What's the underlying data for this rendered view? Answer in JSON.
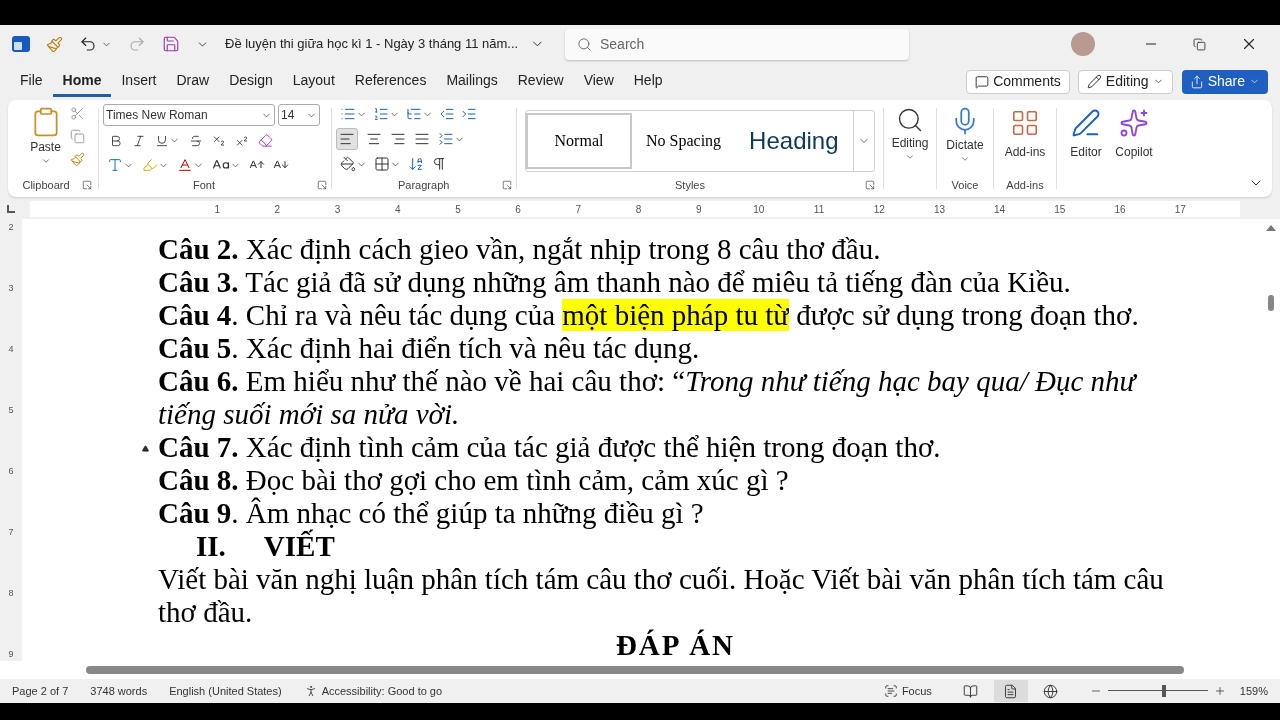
{
  "window": {
    "title": "Đề luyện thi giữa học kì 1 - Ngày 3 tháng 11  năm...",
    "search_placeholder": "Search"
  },
  "tabs": [
    {
      "label": "File",
      "selected": false
    },
    {
      "label": "Home",
      "selected": true
    },
    {
      "label": "Insert",
      "selected": false
    },
    {
      "label": "Draw",
      "selected": false
    },
    {
      "label": "Design",
      "selected": false
    },
    {
      "label": "Layout",
      "selected": false
    },
    {
      "label": "References",
      "selected": false
    },
    {
      "label": "Mailings",
      "selected": false
    },
    {
      "label": "Review",
      "selected": false
    },
    {
      "label": "View",
      "selected": false
    },
    {
      "label": "Help",
      "selected": false
    }
  ],
  "actions": {
    "comments": "Comments",
    "editing": "Editing",
    "share": "Share"
  },
  "ribbon": {
    "paste": "Paste",
    "font_name": "Times New Roman",
    "font_size": "14",
    "groups": [
      "Clipboard",
      "Font",
      "Paragraph",
      "Styles",
      "Voice",
      "Add-ins"
    ],
    "styles": [
      {
        "label": "Normal",
        "kind": "normal",
        "selected": true
      },
      {
        "label": "No Spacing",
        "kind": "nospacing",
        "selected": false
      },
      {
        "label": "Heading",
        "kind": "heading",
        "selected": false
      }
    ],
    "editing": "Editing",
    "dictate": "Dictate",
    "addins": "Add-ins",
    "editor": "Editor",
    "copilot": "Copilot"
  },
  "ruler": [
    "1",
    "2",
    "3",
    "4",
    "5",
    "6",
    "7",
    "8",
    "9",
    "10",
    "11",
    "12",
    "13",
    "14",
    "15",
    "16",
    "17"
  ],
  "vertical_ruler": [
    "2",
    "3",
    "4",
    "5",
    "6",
    "7",
    "8",
    "9"
  ],
  "document": [
    {
      "kind": "question",
      "collapsible": false,
      "segments": [
        {
          "text": "**Câu 2.** Xác định cách gieo vần, ngắt nhịp trong 8 câu thơ đầu.",
          "highlighted": false
        }
      ]
    },
    {
      "kind": "question",
      "collapsible": false,
      "segments": [
        {
          "text": "**Câu 3.** Tác giả đã sử dụng những âm thanh nào để miêu tả tiếng đàn của Kiều.",
          "highlighted": false
        }
      ]
    },
    {
      "kind": "question",
      "collapsible": false,
      "segments": [
        {
          "text": "**Câu 4**. Chỉ ra và nêu tác dụng của ",
          "highlighted": false
        },
        {
          "text": "một biện pháp tu từ",
          "highlighted": true
        },
        {
          "text": " được sử dụng trong đoạn thơ.",
          "highlighted": false
        }
      ]
    },
    {
      "kind": "question",
      "collapsible": false,
      "segments": [
        {
          "text": "**Câu 5**. Xác định hai điển tích và nêu tác dụng.",
          "highlighted": false
        }
      ]
    },
    {
      "kind": "question",
      "collapsible": false,
      "segments": [
        {
          "text": "**Câu 6.** Em hiểu như thế nào về hai câu thơ: “*Trong như tiếng hạc bay qua/ Đục như tiếng suối mới sa nửa vời.*",
          "highlighted": false
        }
      ]
    },
    {
      "kind": "question",
      "collapsible": true,
      "segments": [
        {
          "text": "**Câu 7.** Xác định tình cảm của tác giả được thể hiện trong đoạn thơ.",
          "highlighted": false
        }
      ]
    },
    {
      "kind": "question",
      "collapsible": false,
      "segments": [
        {
          "text": "**Câu 8.** Đọc bài thơ gợi cho em tình cảm, cảm xúc gì ?",
          "highlighted": false
        }
      ]
    },
    {
      "kind": "question",
      "collapsible": false,
      "segments": [
        {
          "text": "**Câu 9**. Âm nhạc có thể giúp ta những điều gì ?",
          "highlighted": false
        }
      ]
    },
    {
      "kind": "heading",
      "number": "II.",
      "text": "VIẾT"
    },
    {
      "kind": "body",
      "segments": [
        {
          "text": "Viết bài văn nghị luận phân tích tám câu thơ cuối. Hoặc Viết bài văn phân tích tám câu thơ đầu.",
          "highlighted": false
        }
      ]
    },
    {
      "kind": "title",
      "text": "ĐÁP ÁN"
    }
  ],
  "status_bar": {
    "page": "Page 2 of 7",
    "words": "3748 words",
    "language": "English (United States)",
    "accessibility": "Accessibility: Good to go",
    "focus": "Focus",
    "views": [
      {
        "kind": "read",
        "selected": false
      },
      {
        "kind": "print",
        "selected": true
      },
      {
        "kind": "web",
        "selected": false
      }
    ],
    "zoom": {
      "level": 0.56,
      "reading": "159%"
    }
  }
}
